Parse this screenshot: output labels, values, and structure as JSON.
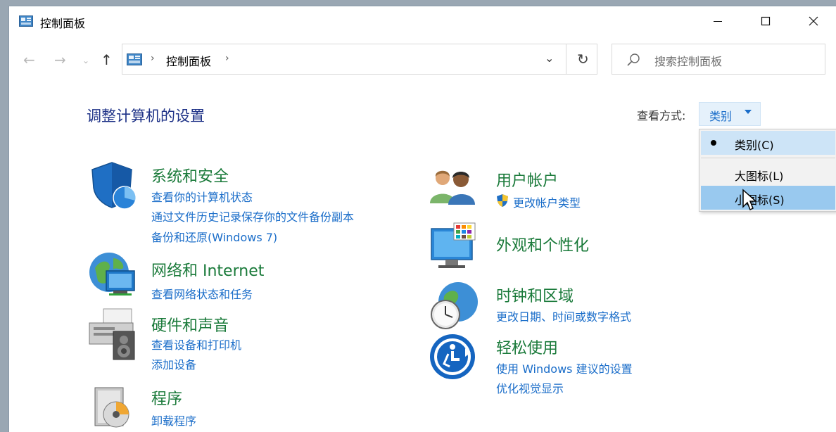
{
  "window": {
    "title": "控制面板",
    "minimize_icon": "minimize-icon",
    "maximize_icon": "maximize-icon",
    "close_icon": "close-icon"
  },
  "nav": {
    "breadcrumb": "控制面板",
    "search_placeholder": "搜索控制面板"
  },
  "main": {
    "heading": "调整计算机的设置",
    "view_by_label": "查看方式:",
    "view_by_value": "类别"
  },
  "view_menu": {
    "items": [
      {
        "label": "类别(C)",
        "selected": true
      },
      {
        "label": "大图标(L)",
        "selected": false
      },
      {
        "label": "小图标(S)",
        "selected": false,
        "hovered": true
      }
    ]
  },
  "categories": {
    "system": {
      "title": "系统和安全",
      "links": [
        "查看你的计算机状态",
        "通过文件历史记录保存你的文件备份副本",
        "备份和还原(Windows 7)"
      ]
    },
    "network": {
      "title": "网络和 Internet",
      "links": [
        "查看网络状态和任务"
      ]
    },
    "hardware": {
      "title": "硬件和声音",
      "links": [
        "查看设备和打印机",
        "添加设备"
      ]
    },
    "programs": {
      "title": "程序",
      "links": [
        "卸载程序"
      ]
    },
    "users": {
      "title": "用户帐户",
      "links": [
        "更改帐户类型"
      ]
    },
    "appearance": {
      "title": "外观和个性化",
      "links": []
    },
    "clock": {
      "title": "时钟和区域",
      "links": [
        "更改日期、时间或数字格式"
      ]
    },
    "ease": {
      "title": "轻松使用",
      "links": [
        "使用 Windows 建议的设置",
        "优化视觉显示"
      ]
    }
  },
  "colors": {
    "accent": "#1a6dc9",
    "category_title": "#1a7a3a",
    "heading": "#1e3287",
    "menu_hover": "#99c9ef"
  }
}
